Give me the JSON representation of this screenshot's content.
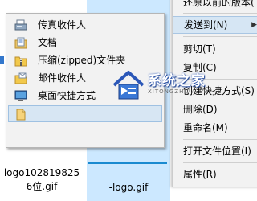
{
  "explorer": {
    "files": [
      {
        "name_line1": "logo102819825",
        "name_line2": "6位.gif"
      },
      {
        "name": "-logo.gif"
      }
    ]
  },
  "context_menu": {
    "top_partial": "还原以前的版本(",
    "items": [
      {
        "label": "发送到(N)",
        "has_submenu": true,
        "highlighted": true
      },
      {
        "label": "剪切(T)"
      },
      {
        "label": "复制(C)"
      },
      {
        "label": "创建快捷方式(S)"
      },
      {
        "label": "删除(D)"
      },
      {
        "label": "重命名(M)"
      },
      {
        "label": "打开文件位置(I)"
      },
      {
        "label": "属性(R)"
      }
    ],
    "submenu_arrow": "▶"
  },
  "sendto_submenu": {
    "items": [
      {
        "label": "传真收件人",
        "icon": "fax-icon"
      },
      {
        "label": "文档",
        "icon": "documents-icon"
      },
      {
        "label": "压缩(zipped)文件夹",
        "icon": "zip-folder-icon"
      },
      {
        "label": "邮件收件人",
        "icon": "mail-recipient-icon"
      },
      {
        "label": "桌面快捷方式",
        "icon": "desktop-shortcut-icon"
      },
      {
        "label": "",
        "icon": "folder-icon",
        "highlighted": true
      }
    ]
  },
  "watermark": {
    "title": "系统之家",
    "url": "XITONGZHIJIA.NET"
  },
  "colors": {
    "menu_bg": "#f2f2f2",
    "highlight": "#d7e6f3",
    "selection": "#cce8ff"
  }
}
